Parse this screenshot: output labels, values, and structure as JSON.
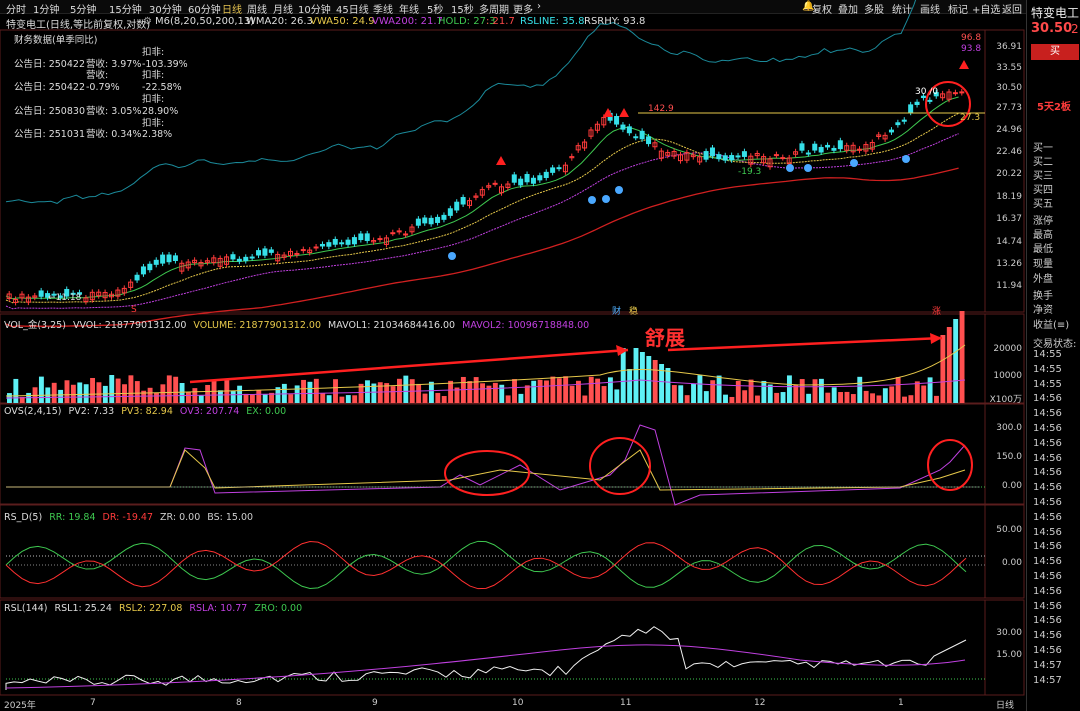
{
  "toolbar": {
    "periods": [
      "分时",
      "1分钟",
      "5分钟",
      "15分钟",
      "30分钟",
      "60分钟",
      "日线",
      "周线",
      "月线",
      "10分钟",
      "45日线",
      "季线",
      "年线",
      "5秒",
      "15秒",
      "多周期",
      "更多"
    ],
    "selected": "日线",
    "right": [
      "复权",
      "叠加",
      "多股",
      "统计",
      "画线",
      "标记",
      "+自选",
      "返回"
    ]
  },
  "header": {
    "name": "特变电工(日线,等比前复权,对数)",
    "ma": "M6(8,20,50,200,13)",
    "wma20": "WMA20: 26.3",
    "vwa50": "VWA50: 24.9",
    "vwa200": "VWA200: 21.7",
    "hold": "HOLD: 27.3",
    "hold2": ": 21.7",
    "rsline": "RSLINE: 35.8",
    "rsrhy": "RSRHY: 93.8"
  },
  "finance": {
    "title": "财务数据(单季同比)",
    "rows": [
      {
        "date": "公告日: 250422",
        "rev": "营收: 3.97%",
        "np": "扣非: -103.39%"
      },
      {
        "date": "公告日: 250422",
        "rev": "营收: -0.79%",
        "np": "扣非: -22.58%"
      },
      {
        "date": "公告日: 250830",
        "rev": "营收: 3.05%",
        "np": "扣非: 28.90%"
      },
      {
        "date": "公告日: 251031",
        "rev": "营收: 0.34%",
        "np": "扣非: 2.38%"
      }
    ]
  },
  "price_axis": [
    "36.91",
    "33.55",
    "30.50",
    "27.73",
    "24.96",
    "22.46",
    "20.22",
    "18.19",
    "16.37",
    "14.74",
    "13.26",
    "11.94"
  ],
  "price_labels": {
    "max": "96.8",
    "rs": "93.8",
    "low": "11.18",
    "p142": "142.9",
    "d193": "-19.3",
    "v3010": "30 /0",
    "v273": "27.3"
  },
  "markers": {
    "cai": "财",
    "wen": "稳",
    "zhang": "涨",
    "s": "S"
  },
  "volume": {
    "name": "VOL_金(3,25)",
    "vvol": "VVOL: 21877901312.00",
    "volume": "VOLUME: 21877901312.00",
    "mavol1": "MAVOL1: 21034684416.00",
    "mavol2": "MAVOL2: 10096718848.00",
    "axis": [
      "20000",
      "10000"
    ],
    "unit": "X100万",
    "annotation": "舒展"
  },
  "ovs": {
    "name": "OVS(2,4,15)",
    "pv2": "PV2: 7.33",
    "pv3": "PV3: 82.94",
    "ov3": "OV3: 207.74",
    "ex": "EX: 0.00",
    "axis": [
      "300.0",
      "150.0",
      "0.00"
    ]
  },
  "rsd": {
    "name": "RS_D(5)",
    "rr": "RR: 19.84",
    "dr": "DR: -19.47",
    "zr": "ZR: 0.00",
    "bs": "BS: 15.00",
    "axis": [
      "50.00",
      "0.00"
    ]
  },
  "rsl": {
    "name": "RSL(144)",
    "rsl1": "RSL1: 25.24",
    "rsl2": "RSL2: 227.08",
    "rsla": "RSLA: 10.77",
    "zro": "ZRO: 0.00",
    "axis": [
      "30.00",
      "15.00"
    ]
  },
  "xaxis": {
    "labels": [
      "2025年",
      "7",
      "8",
      "9",
      "10",
      "11",
      "12",
      "1"
    ],
    "right": "日线"
  },
  "side": {
    "name": "特变电工",
    "price": "30.50",
    "price2": "2",
    "buy_btn": "买",
    "tag": "5天2板",
    "items": [
      "买一",
      "买二",
      "买三",
      "买四",
      "买五",
      "涨停",
      "最高",
      "最低",
      "现量",
      "外盘",
      "换手",
      "净资",
      "收益(≡)",
      "交易状态:"
    ],
    "times": [
      "14:55",
      "14:55",
      "14:55",
      "14:56",
      "14:56",
      "14:56",
      "14:56",
      "14:56",
      "14:56",
      "14:56",
      "14:56",
      "14:56",
      "14:56",
      "14:56",
      "14:56",
      "14:56",
      "14:56",
      "14:56",
      "14:56",
      "14:56",
      "14:56",
      "14:57",
      "14:57"
    ]
  },
  "colors": {
    "up": "#ff3b3b",
    "down": "#36e0e8",
    "yellow": "#e6c84a",
    "purple": "#c040e0",
    "green": "#3ec850",
    "gridline": "#444"
  }
}
